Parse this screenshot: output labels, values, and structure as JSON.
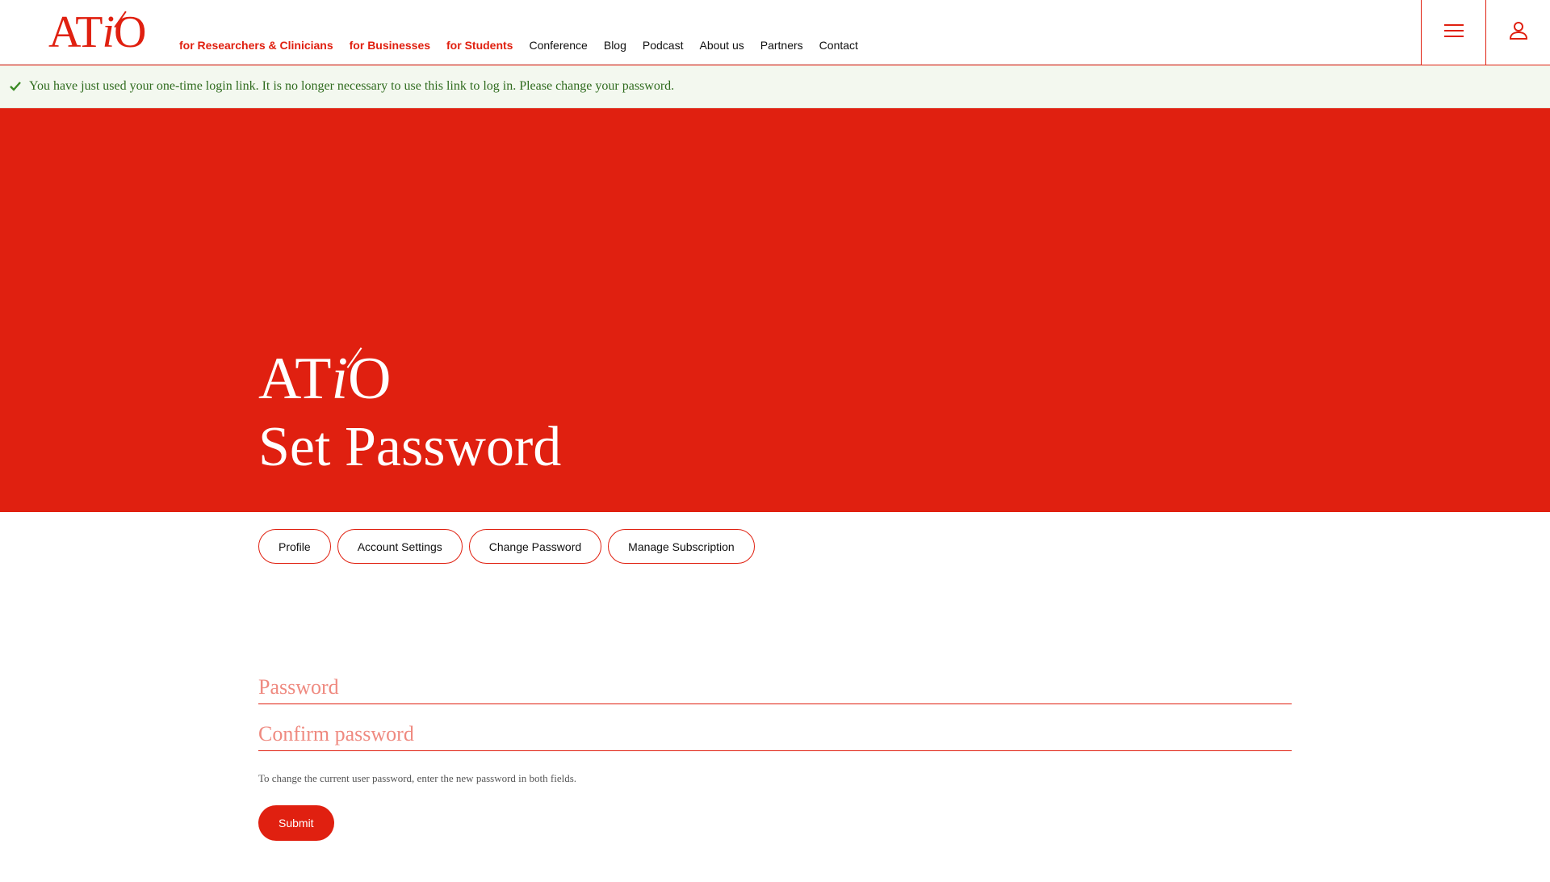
{
  "header": {
    "logo_text": "ATiO",
    "nav": [
      {
        "label": "for Researchers & Clinicians"
      },
      {
        "label": "for Businesses"
      },
      {
        "label": "for Students"
      },
      {
        "label": "Conference"
      },
      {
        "label": "Blog"
      },
      {
        "label": "Podcast"
      },
      {
        "label": "About us"
      },
      {
        "label": "Partners"
      },
      {
        "label": "Contact"
      }
    ],
    "icons": [
      "menu-icon",
      "user-icon"
    ]
  },
  "message": {
    "text": "You have just used your one-time login link. It is no longer necessary to use this link to log in. Please change your password.",
    "icon": "check-icon"
  },
  "hero": {
    "logo_text": "ATiO",
    "title": "Set Password"
  },
  "tabs": [
    {
      "label": "Profile"
    },
    {
      "label": "Account Settings"
    },
    {
      "label": "Change Password"
    },
    {
      "label": "Manage Subscription"
    }
  ],
  "form": {
    "password_placeholder": "Password",
    "confirm_placeholder": "Confirm password",
    "password_value": "",
    "confirm_value": "",
    "help_text": "To change the current user password, enter the new password in both fields.",
    "submit_label": "Submit"
  },
  "colors": {
    "accent": "#e02010",
    "message_bg": "#f3f8ef",
    "message_text": "#2f6b1e"
  }
}
